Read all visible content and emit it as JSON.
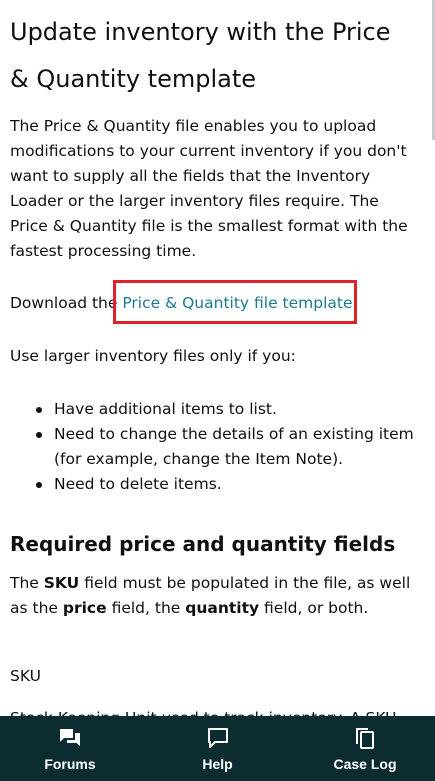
{
  "article": {
    "title": "Update inventory with the Price & Quantity template",
    "intro": "The Price & Quantity file enables you to upload modifications to your current inventory if you don't want to supply all the fields that the Inventory Loader or the larger inventory files require. The Price & Quantity file is the smallest format with the fastest processing time.",
    "download_prefix": "Download the ",
    "download_link": "Price & Quantity file template",
    "download_suffix": ".",
    "larger_intro": "Use larger inventory files only if you:",
    "bullets": [
      "Have additional items to list.",
      "Need to change the details of an existing item (for example, change the Item Note).",
      "Need to delete items."
    ],
    "required_heading": "Required price and quantity fields",
    "required": {
      "t1": "The ",
      "b1": "SKU",
      "t2": " field must be populated in the file, as well as the ",
      "b2": "price",
      "t3": " field, the ",
      "b3": "quantity",
      "t4": " field, or both."
    },
    "sku_label": "SKU",
    "sku_desc_cut": "Stock Keeping Unit used to track inventory. A SKU"
  },
  "nav": {
    "forums": "Forums",
    "help": "Help",
    "case_log": "Case Log"
  },
  "icons": {
    "forums": "forums-icon",
    "help": "help-icon",
    "case_log": "case-log-icon"
  },
  "colors": {
    "link": "#1c7b8f",
    "highlight": "#e0202b",
    "nav_background": "#0d2c31"
  }
}
